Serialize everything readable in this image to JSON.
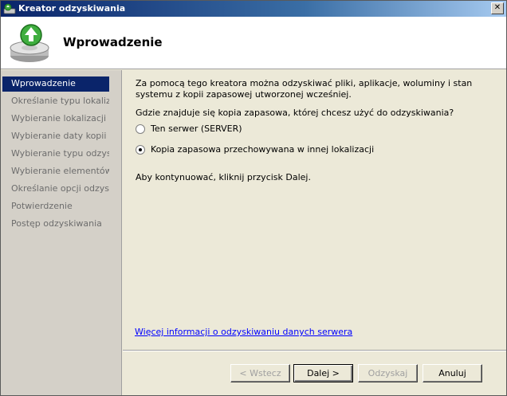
{
  "window": {
    "title": "Kreator odzyskiwania",
    "close_label": "✕"
  },
  "header": {
    "title": "Wprowadzenie"
  },
  "sidebar": {
    "items": [
      {
        "label": "Wprowadzenie",
        "active": true
      },
      {
        "label": "Określanie typu lokalizacji",
        "active": false
      },
      {
        "label": "Wybieranie lokalizacji k...",
        "active": false
      },
      {
        "label": "Wybieranie daty kopii z...",
        "active": false
      },
      {
        "label": "Wybieranie typu odzys...",
        "active": false
      },
      {
        "label": "Wybieranie elementów...",
        "active": false
      },
      {
        "label": "Określanie opcji odzysk...",
        "active": false
      },
      {
        "label": "Potwierdzenie",
        "active": false
      },
      {
        "label": "Postęp odzyskiwania",
        "active": false
      }
    ]
  },
  "main": {
    "intro": "Za pomocą tego kreatora można odzyskiwać pliki, aplikacje, woluminy i stan systemu z kopii zapasowej utworzonej wcześniej.",
    "question": "Gdzie znajduje się kopia zapasowa, której chcesz użyć do odzyskiwania?",
    "options": [
      {
        "label": "Ten serwer (SERVER)",
        "checked": false
      },
      {
        "label": "Kopia zapasowa przechowywana w innej lokalizacji",
        "checked": true
      }
    ],
    "continue_text": "Aby kontynuować, kliknij przycisk Dalej.",
    "more_info_link": "Więcej informacji o odzyskiwaniu danych serwera"
  },
  "buttons": {
    "back": "< Wstecz",
    "next": "Dalej >",
    "recover": "Odzyskaj",
    "cancel": "Anuluj"
  },
  "colors": {
    "active_nav": "#0a246a",
    "link": "#0000ff"
  }
}
